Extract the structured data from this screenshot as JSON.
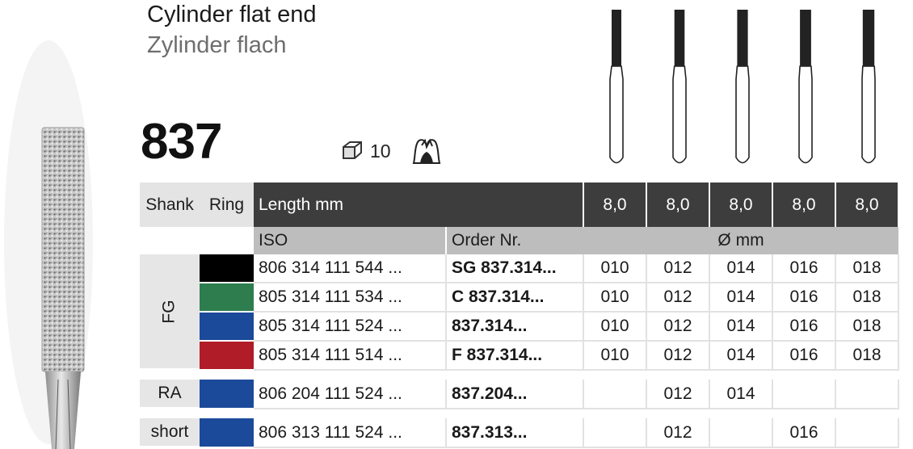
{
  "header": {
    "title_en": "Cylinder flat end",
    "title_de": "Zylinder flach",
    "model_number": "837",
    "pack_quantity": "10",
    "pack_icon": "package-box-icon",
    "application_icon": "tooth-icon"
  },
  "table": {
    "headers": {
      "shank": "Shank",
      "ring": "Ring",
      "length": "Length mm",
      "iso": "ISO",
      "order": "Order Nr.",
      "diameter": "Ø mm"
    },
    "lengths": [
      "8,0",
      "8,0",
      "8,0",
      "8,0",
      "8,0"
    ],
    "groups": {
      "fg": "FG",
      "ra": "RA",
      "short": "short"
    },
    "rows": [
      {
        "ring_color": "#000000",
        "iso": "806 314 111 544 ...",
        "order": "SG 837.314...",
        "sizes": [
          "010",
          "012",
          "014",
          "016",
          "018"
        ]
      },
      {
        "ring_color": "#2e7d4f",
        "iso": "805 314 111 534 ...",
        "order": "C 837.314...",
        "sizes": [
          "010",
          "012",
          "014",
          "016",
          "018"
        ]
      },
      {
        "ring_color": "#1c4a9a",
        "iso": "805 314 111 524 ...",
        "order": "837.314...",
        "sizes": [
          "010",
          "012",
          "014",
          "016",
          "018"
        ]
      },
      {
        "ring_color": "#b01c27",
        "iso": "805 314 111 514 ...",
        "order": "F 837.314...",
        "sizes": [
          "010",
          "012",
          "014",
          "016",
          "018"
        ]
      },
      {
        "ring_color": "#1c4a9a",
        "iso": "806 204 111 524 ...",
        "order": "837.204...",
        "sizes": [
          "",
          "012",
          "014",
          "",
          ""
        ]
      },
      {
        "ring_color": "#1c4a9a",
        "iso": "806 313 111 524 ...",
        "order": "837.313...",
        "sizes": [
          "",
          "012",
          "",
          "016",
          ""
        ]
      }
    ]
  },
  "colors": {
    "header_dark": "#3d3d3d",
    "header_grey": "#bdbdbd",
    "header_light": "#e4e4e4"
  }
}
